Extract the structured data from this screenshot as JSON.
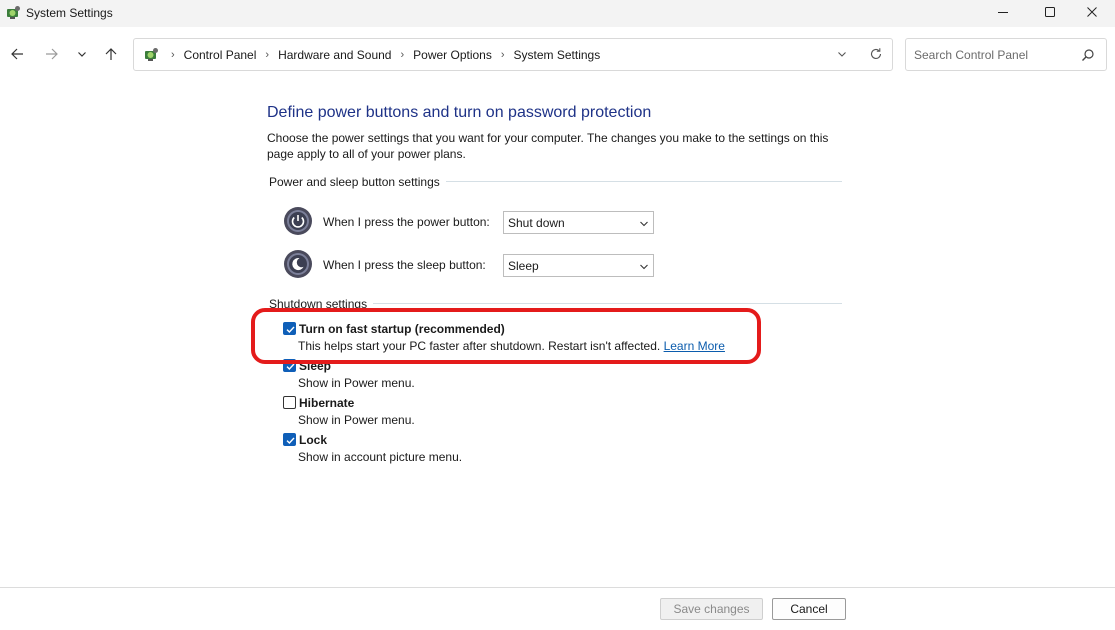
{
  "window": {
    "title": "System Settings",
    "icons": {
      "app": "control-panel-icon",
      "minimize": "minimize-icon",
      "maximize": "maximize-icon",
      "close": "close-icon"
    }
  },
  "nav": {
    "breadcrumb": [
      "Control Panel",
      "Hardware and Sound",
      "Power Options",
      "System Settings"
    ],
    "search_placeholder": "Search Control Panel",
    "icons": {
      "back": "arrow-left-icon",
      "forward": "arrow-right-icon",
      "recent": "chevron-down-icon",
      "up": "arrow-up-icon",
      "refresh": "refresh-icon",
      "search": "search-icon"
    }
  },
  "main": {
    "heading": "Define power buttons and turn on password protection",
    "description": "Choose the power settings that you want for your computer. The changes you make to the settings on this page apply to all of your power plans.",
    "power_group": {
      "label": "Power and sleep button settings",
      "power_button": {
        "label": "When I press the power button:",
        "value": "Shut down",
        "icon": "power-button-icon"
      },
      "sleep_button": {
        "label": "When I press the sleep button:",
        "value": "Sleep",
        "icon": "sleep-button-icon"
      }
    },
    "shutdown_group": {
      "label": "Shutdown settings",
      "options": [
        {
          "title": "Turn on fast startup (recommended)",
          "desc": "This helps start your PC faster after shutdown. Restart isn't affected.",
          "link": "Learn More",
          "checked": true
        },
        {
          "title": "Sleep",
          "desc": "Show in Power menu.",
          "checked": true
        },
        {
          "title": "Hibernate",
          "desc": "Show in Power menu.",
          "checked": false
        },
        {
          "title": "Lock",
          "desc": "Show in account picture menu.",
          "checked": true
        }
      ]
    }
  },
  "footer": {
    "save_label": "Save changes",
    "cancel_label": "Cancel"
  },
  "colors": {
    "heading": "#1e3287",
    "link": "#0b5cad",
    "checkbox": "#0f5fb8",
    "highlight": "#e41b1b"
  }
}
